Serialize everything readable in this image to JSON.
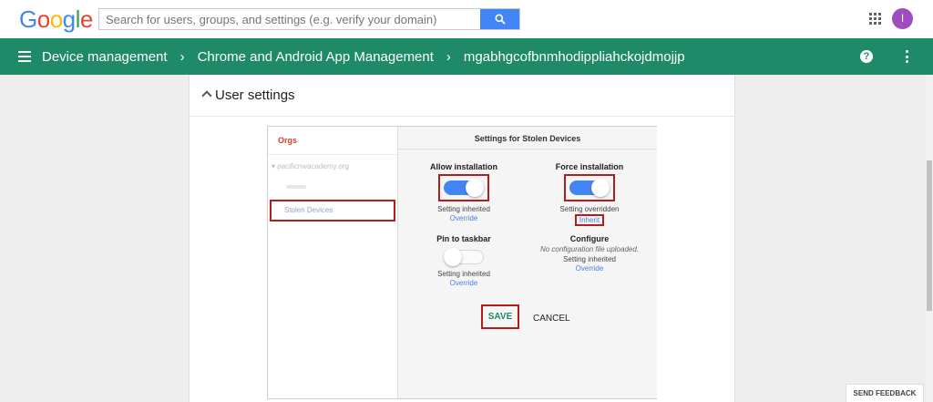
{
  "brand": {
    "logo_letters": [
      {
        "ch": "G",
        "color": "#4285f4"
      },
      {
        "ch": "o",
        "color": "#ea4335"
      },
      {
        "ch": "o",
        "color": "#fbbc05"
      },
      {
        "ch": "g",
        "color": "#4285f4"
      },
      {
        "ch": "l",
        "color": "#34a853"
      },
      {
        "ch": "e",
        "color": "#ea4335"
      }
    ]
  },
  "search": {
    "placeholder": "Search for users, groups, and settings (e.g. verify your domain)"
  },
  "account": {
    "avatar_letter": "I"
  },
  "header": {
    "breadcrumbs": [
      "Device management",
      "Chrome and Android App Management",
      "mgabhgcofbnmhodippliahckojdmojjp"
    ],
    "separator": "›"
  },
  "section": {
    "title": "User settings"
  },
  "orgs": {
    "title": "Orgs",
    "root": "pacificnwacademy.org",
    "selected": "Stolen Devices"
  },
  "settings": {
    "title": "Settings for Stolen Devices",
    "allow_installation": {
      "label": "Allow installation",
      "state": "on",
      "status": "Setting inherited",
      "action": "Override"
    },
    "force_installation": {
      "label": "Force installation",
      "state": "on",
      "status": "Setting overridden",
      "action": "Inherit"
    },
    "pin_to_taskbar": {
      "label": "Pin to taskbar",
      "state": "off",
      "status": "Setting inherited",
      "action": "Override"
    },
    "configure": {
      "label": "Configure",
      "note": "No configuration file uploaded.",
      "status": "Setting inherited",
      "action": "Override"
    }
  },
  "actions": {
    "save": "SAVE",
    "cancel": "CANCEL"
  },
  "footer": {
    "feedback": "SEND FEEDBACK"
  },
  "colors": {
    "header_green": "#1e8a67",
    "accent_blue": "#4285f4",
    "highlight_red": "#b71c1c",
    "orgs_red": "#d23f31"
  }
}
